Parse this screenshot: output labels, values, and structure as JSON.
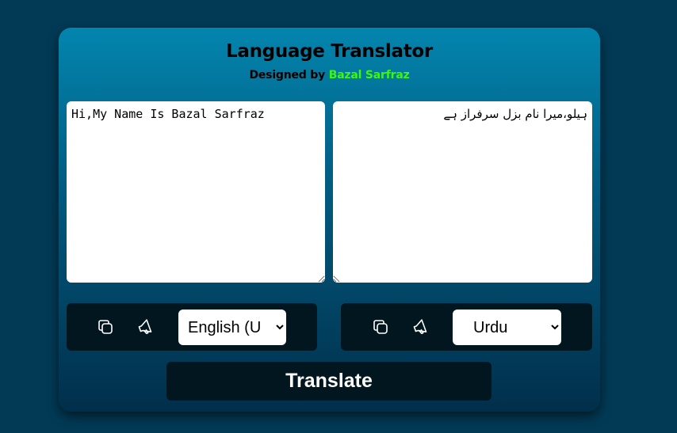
{
  "app": {
    "title": "Language Translator",
    "subtitle_prefix": "Designed by ",
    "author": "Bazal Sarfraz"
  },
  "source": {
    "text": "Hi,My Name Is Bazal Sarfraz",
    "language": "English (U",
    "icons": [
      "copy-icon",
      "speaker-icon"
    ]
  },
  "target": {
    "text": "ہیلو،میرا نام بزل سرفراز ہے",
    "language": "Urdu",
    "icons": [
      "copy-icon",
      "speaker-icon"
    ]
  },
  "actions": {
    "translate_label": "Translate"
  },
  "colors": {
    "page_background": "#023a55",
    "card_gradient_top": "#0385ae",
    "card_gradient_bottom": "#012f4b",
    "accent_author": "#3cf712",
    "control_bar": "#01161f"
  }
}
